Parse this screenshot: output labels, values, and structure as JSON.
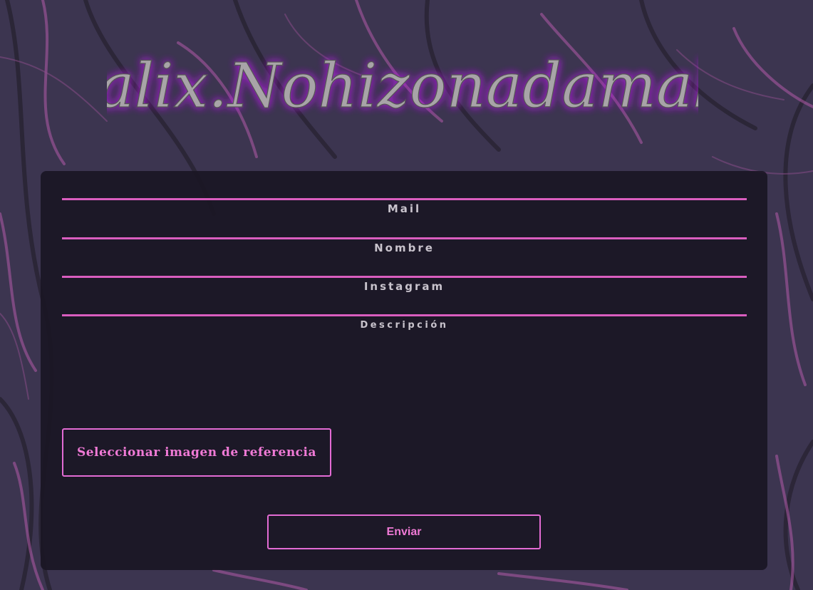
{
  "header": {
    "logo_text": "Salix.Nohizonadamalo"
  },
  "form": {
    "fields": [
      {
        "label": "Mail"
      },
      {
        "label": "Nombre"
      },
      {
        "label": "Instagram"
      },
      {
        "label": "Descripción"
      }
    ],
    "image_button_label": "Seleccionar imagen de referencia",
    "submit_label": "Enviar"
  },
  "colors": {
    "background": "#3c3550",
    "branch_pink": "#b05aa8",
    "panel": "#1a1624",
    "accent": "#d95dbf",
    "button_text": "#f07ad6",
    "label_text": "#c8c3cc",
    "logo_fill": "#a8a4a8",
    "logo_glow": "#b020e0"
  },
  "icons": {
    "logo": "metal-style-logo"
  }
}
